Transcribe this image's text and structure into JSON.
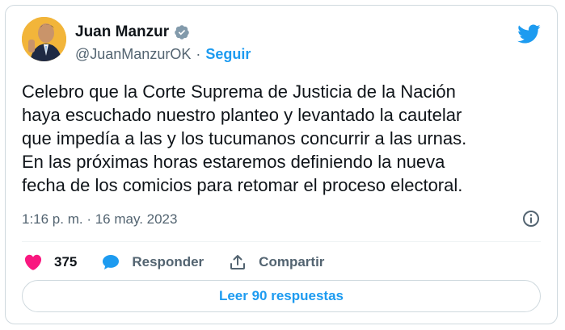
{
  "author": {
    "name": "Juan Manzur",
    "handle": "@JuanManzurOK",
    "separator": "·",
    "follow_label": "Seguir",
    "verified": true
  },
  "tweet": {
    "text": "Celebro que la Corte Suprema de Justicia de la Nación\nhaya escuchado nuestro planteo y levantado la cautelar\nque impedía a las y los tucumanos concurrir a las urnas.\nEn las próximas horas estaremos definiendo la nueva\nfecha de los comicios para retomar el proceso electoral.",
    "timestamp": "1:16 p. m. · 16 may. 2023"
  },
  "actions": {
    "likes_count": "375",
    "reply_label": "Responder",
    "share_label": "Compartir"
  },
  "read_replies_label": "Leer 90 respuestas",
  "colors": {
    "accent": "#1d9bf0",
    "like": "#f91880",
    "text": "#0f1419",
    "muted": "#536471",
    "border": "#cfd9de",
    "avatar_bg": "#f2b53a"
  },
  "icons": {
    "bird": "twitter-bird-icon",
    "verified": "verified-badge-icon",
    "info": "info-icon",
    "like": "heart-icon",
    "reply": "speech-bubble-icon",
    "share": "share-upload-icon"
  }
}
